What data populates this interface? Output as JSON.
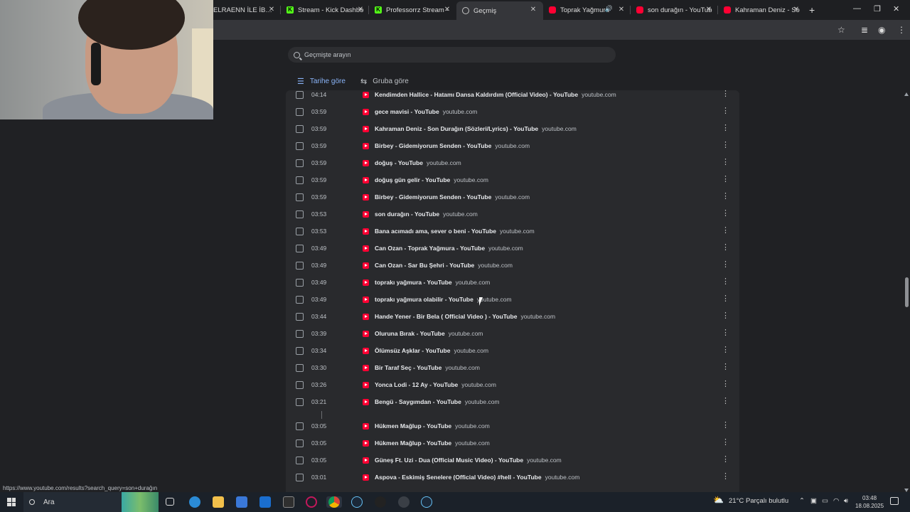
{
  "tabs": [
    {
      "title": "ELRAENN İLE İBLİS İN",
      "favicon": "partial-tab-icon"
    },
    {
      "title": "Stream - Kick Dashbo",
      "favicon": "kick-icon"
    },
    {
      "title": "Professorrz Stream -",
      "favicon": "kick-icon"
    },
    {
      "title": "Geçmiş",
      "favicon": "history-icon"
    },
    {
      "title": "Toprak Yağmura",
      "favicon": "youtube-icon"
    },
    {
      "title": "son durağın - YouTub",
      "favicon": "youtube-icon"
    },
    {
      "title": "Kahraman Deniz - So",
      "favicon": "youtube-icon"
    }
  ],
  "search": {
    "placeholder": "Geçmişte arayın"
  },
  "view_tabs": {
    "by_date": "Tarihe göre",
    "by_group": "Gruba göre"
  },
  "history": [
    {
      "time": "04:14",
      "title": "Kendimden Hallice - Hatamı Dansa Kaldırdım (Official Video) - YouTube",
      "domain": "youtube.com"
    },
    {
      "time": "03:59",
      "title": "gece mavisi - YouTube",
      "domain": "youtube.com"
    },
    {
      "time": "03:59",
      "title": "Kahraman Deniz - Son Durağın (Sözleri/Lyrics) - YouTube",
      "domain": "youtube.com"
    },
    {
      "time": "03:59",
      "title": "Birbey - Gidemiyorum Senden - YouTube",
      "domain": "youtube.com"
    },
    {
      "time": "03:59",
      "title": "doğuş - YouTube",
      "domain": "youtube.com"
    },
    {
      "time": "03:59",
      "title": "doğuş gün gelir - YouTube",
      "domain": "youtube.com"
    },
    {
      "time": "03:59",
      "title": "Birbey - Gidemiyorum Senden - YouTube",
      "domain": "youtube.com"
    },
    {
      "time": "03:53",
      "title": "son durağın - YouTube",
      "domain": "youtube.com"
    },
    {
      "time": "03:53",
      "title": "Bana acımadı ama, sever o beni - YouTube",
      "domain": "youtube.com"
    },
    {
      "time": "03:49",
      "title": "Can Ozan - Toprak Yağmura - YouTube",
      "domain": "youtube.com"
    },
    {
      "time": "03:49",
      "title": "Can Ozan - Sar Bu Şehri - YouTube",
      "domain": "youtube.com"
    },
    {
      "time": "03:49",
      "title": "toprakı yağmura - YouTube",
      "domain": "youtube.com"
    },
    {
      "time": "03:49",
      "title": "toprakı yağmura olabilir - YouTube",
      "domain": "youtube.com"
    },
    {
      "time": "03:44",
      "title": "Hande Yener - Bir Bela ( Official Video ) - YouTube",
      "domain": "youtube.com"
    },
    {
      "time": "03:39",
      "title": "Oluruna Bırak - YouTube",
      "domain": "youtube.com"
    },
    {
      "time": "03:34",
      "title": "Ölümsüz Aşklar - YouTube",
      "domain": "youtube.com"
    },
    {
      "time": "03:30",
      "title": "Bir Taraf Seç - YouTube",
      "domain": "youtube.com"
    },
    {
      "time": "03:26",
      "title": "Yonca Lodi - 12 Ay - YouTube",
      "domain": "youtube.com"
    },
    {
      "time": "03:21",
      "title": "Bengü - Saygımdan - YouTube",
      "domain": "youtube.com"
    },
    {
      "time": "03:05",
      "title": "Hükmen Mağlup - YouTube",
      "domain": "youtube.com"
    },
    {
      "time": "03:05",
      "title": "Hükmen Mağlup - YouTube",
      "domain": "youtube.com"
    },
    {
      "time": "03:05",
      "title": "Güneş Ft. Uzi - Dua (Official Music Video) - YouTube",
      "domain": "youtube.com"
    },
    {
      "time": "03:01",
      "title": "Aspova - Eskimiş Senelere (Official Video) #hell - YouTube",
      "domain": "youtube.com"
    }
  ],
  "status_url": "https://www.youtube.com/results?search_query=son+durağın",
  "taskbar": {
    "search_label": "Ara",
    "weather": "21°C",
    "weather_desc": "Parçalı bulutlu",
    "time": "03:48",
    "date": "18.08.2025"
  },
  "colors": {
    "accent": "#8ab4f8",
    "youtube": "#ff0033",
    "kick": "#53fc18"
  }
}
